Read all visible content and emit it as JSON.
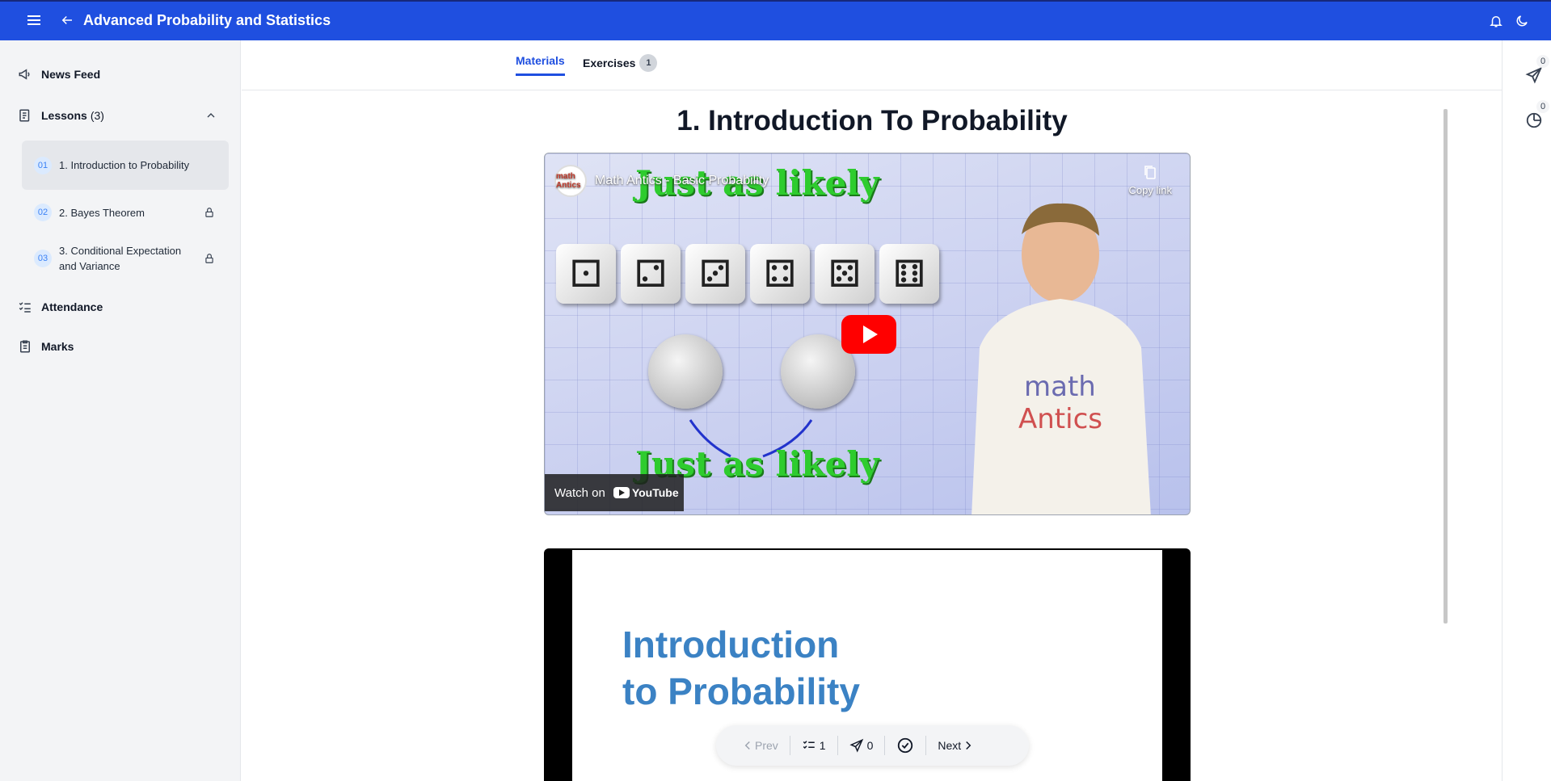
{
  "header": {
    "title": "Advanced Probability and Statistics",
    "menu_icon": "hamburger-menu-icon",
    "back_icon": "arrow-left-icon",
    "notifications_icon": "bell-icon",
    "theme_icon": "moon-icon",
    "bg_color": "#1f4fe0"
  },
  "sidebar": {
    "news_feed": "News Feed",
    "lessons_label": "Lessons",
    "lessons_count": "(3)",
    "lessons": [
      {
        "num": "01",
        "title": "1. Introduction to Probability",
        "locked": false,
        "active": true
      },
      {
        "num": "02",
        "title": "2. Bayes Theorem",
        "locked": true,
        "active": false
      },
      {
        "num": "03",
        "title": "3. Conditional Expectation and Variance",
        "locked": true,
        "active": false
      }
    ],
    "attendance": "Attendance",
    "marks": "Marks"
  },
  "tabs": {
    "materials": "Materials",
    "exercises": "Exercises",
    "exercises_badge": "1"
  },
  "right_rail": {
    "send_count": "0",
    "clock_count": "0"
  },
  "content": {
    "lesson_title": "1. Introduction To Probability",
    "video": {
      "channel_logo": "math Antics",
      "title": "Math Antics - Basic Probability",
      "copy_link": "Copy link",
      "top_text": "Just as likely",
      "bottom_text": "Just as likely",
      "watch_on": "Watch on",
      "youtube": "YouTube"
    },
    "slide": {
      "title_line1": "Introduction",
      "title_line2": "to Probability"
    }
  },
  "pager": {
    "prev": "Prev",
    "exercises_count": "1",
    "send_count": "0",
    "next": "Next"
  }
}
